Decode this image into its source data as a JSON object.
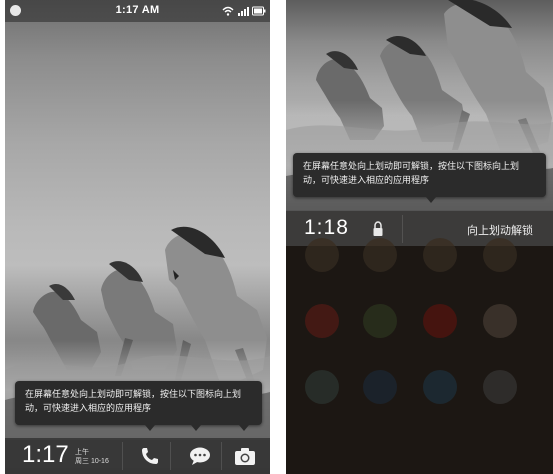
{
  "left_screen": {
    "status_bar": {
      "time": "1:17 AM",
      "left_icon": "notification-dot-icon",
      "right_icons": [
        "wifi-icon",
        "signal-icon",
        "battery-icon"
      ]
    },
    "tooltip_text": "在屏幕任意处向上划动即可解锁，按住以下图标向上划动，可快速进入相应的应用程序",
    "lock_bar": {
      "time": "1:17",
      "date_line1": "上午",
      "date_line2": "周三  10-16",
      "shortcuts": [
        "phone-icon",
        "message-icon",
        "camera-icon"
      ]
    }
  },
  "right_screen": {
    "tooltip_text": "在屏幕任意处向上划动即可解锁，按住以下图标向上划动，可快速进入相应的应用程序",
    "unlock_bar": {
      "time": "1:18",
      "lock_icon": "lock-icon",
      "hint": "向上划动解锁"
    },
    "home_apps": [
      {
        "label": "",
        "color": "#3a3026"
      },
      {
        "label": "",
        "color": "#3a3026"
      },
      {
        "label": "",
        "color": "#3a3026"
      },
      {
        "label": "",
        "color": "#3a3026"
      },
      {
        "label": "",
        "color": "#5a1d18"
      },
      {
        "label": "",
        "color": "#2f3a22"
      },
      {
        "label": "",
        "color": "#5c1410"
      },
      {
        "label": "",
        "color": "#4a4038"
      },
      {
        "label": "",
        "color": "#2e3a36"
      },
      {
        "label": "",
        "color": "#1d2a3a"
      },
      {
        "label": "",
        "color": "#1e3442"
      },
      {
        "label": "",
        "color": "#3a3a3a"
      }
    ]
  },
  "colors": {
    "bar_dark": "#373737",
    "tooltip_bg": "#2b2b2b",
    "home_bg": "#1e1a16"
  }
}
